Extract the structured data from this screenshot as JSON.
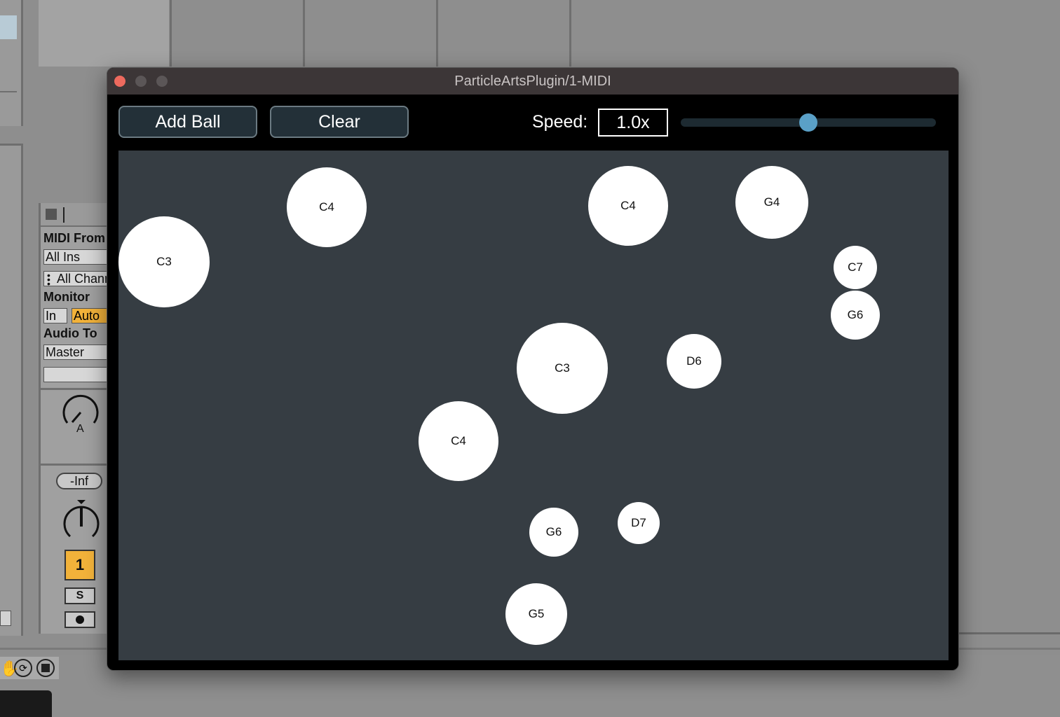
{
  "daw": {
    "midi_from_label": "MIDI From",
    "midi_from_value": "All Ins",
    "channel_value": "All Channels",
    "monitor_label": "Monitor",
    "monitor_in": "In",
    "monitor_auto": "Auto",
    "audio_to_label": "Audio To",
    "audio_to_value": "Master",
    "knob_label": "A",
    "volume_readout": "-Inf",
    "track_number": "1",
    "solo_label": "S"
  },
  "window": {
    "title": "ParticleArtsPlugin/1-MIDI"
  },
  "toolbar": {
    "add_ball_label": "Add Ball",
    "clear_label": "Clear",
    "speed_label": "Speed:",
    "speed_value": "1.0x",
    "speed_slider_fraction": 0.5
  },
  "balls": [
    {
      "note": "C4"
    },
    {
      "note": "C4"
    },
    {
      "note": "G4"
    },
    {
      "note": "C3"
    },
    {
      "note": "C7"
    },
    {
      "note": "G6"
    },
    {
      "note": "C3"
    },
    {
      "note": "D6"
    },
    {
      "note": "C4"
    },
    {
      "note": "G6"
    },
    {
      "note": "D7"
    },
    {
      "note": "G5"
    }
  ],
  "colors": {
    "close": "#ed6a5e",
    "inactive_button": "#5b5657",
    "canvas_bg": "#363d43",
    "ball": "#ffffff",
    "slider_thumb": "#5aa0c7",
    "track_orange": "#f2b23a"
  }
}
